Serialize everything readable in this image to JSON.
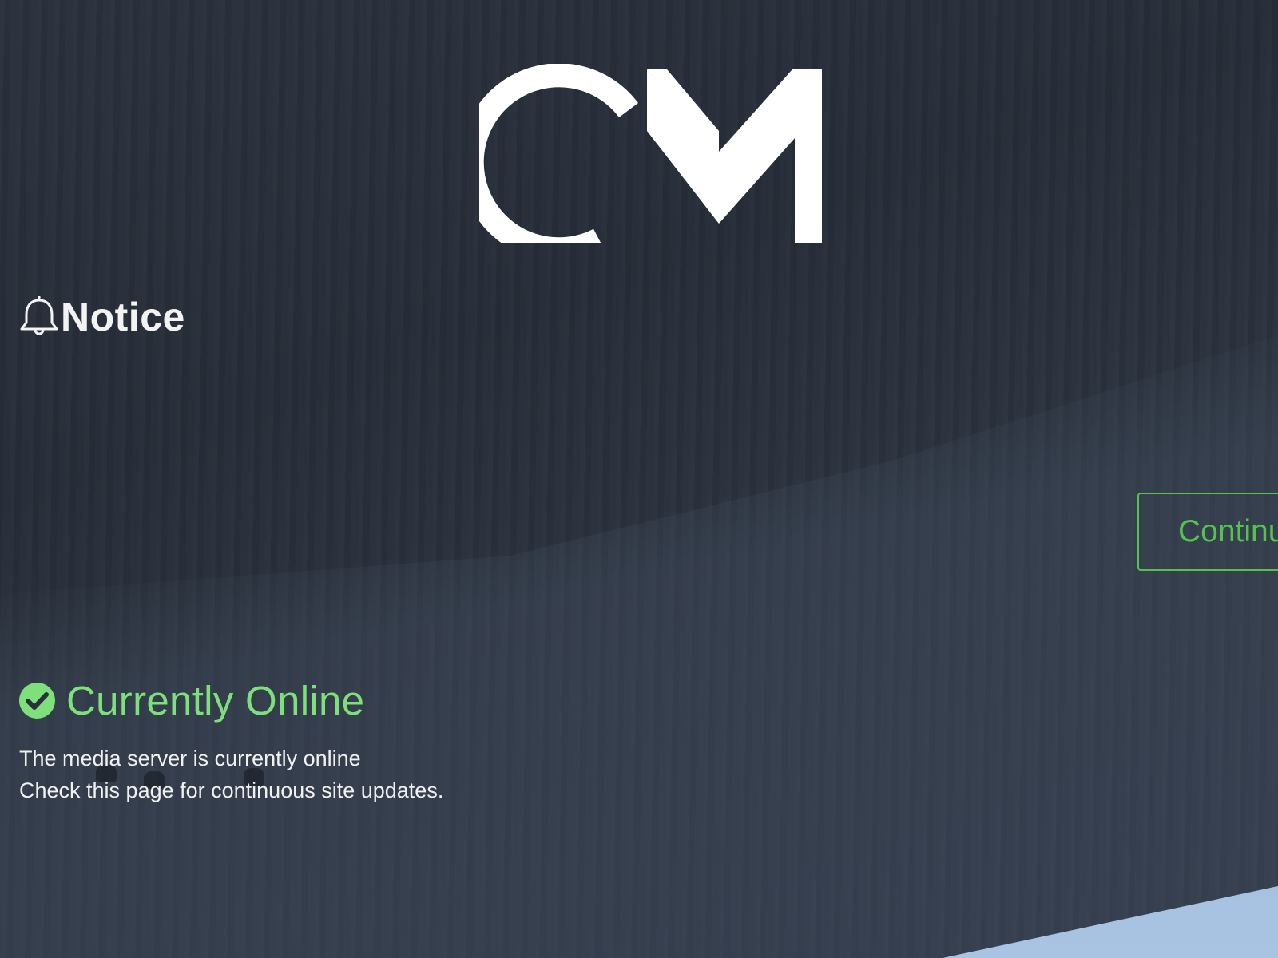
{
  "brand": {
    "logo_text": "CM"
  },
  "notice": {
    "title": "Notice",
    "icon": "bell-icon"
  },
  "actions": {
    "continue_label": "Continue",
    "accent_color": "#55c24f"
  },
  "status": {
    "title": "Currently Online",
    "icon": "check-circle-icon",
    "color": "#7ee07a",
    "lines": [
      "The media server is currently online",
      "Check this page for continuous site updates."
    ]
  }
}
